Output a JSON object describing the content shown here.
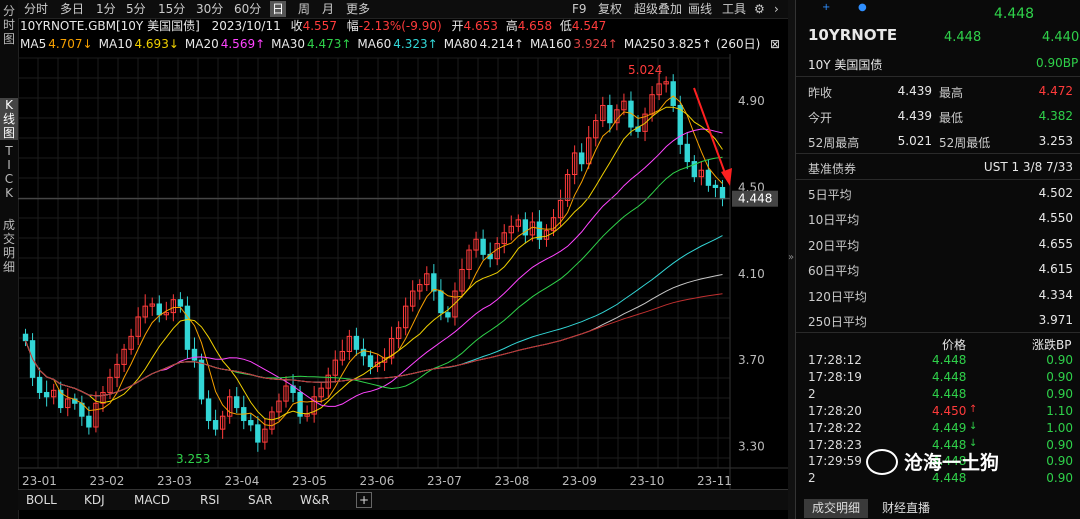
{
  "left_tabs": [
    "分\n时\n图",
    "K\n线\n图",
    "T\nI\nC\nK",
    "成\n交\n明\n细"
  ],
  "period_tabs": [
    "分时",
    "多日",
    "1分",
    "5分",
    "15分",
    "30分",
    "60分",
    "日",
    "周",
    "月",
    "更多"
  ],
  "toolbar_right": [
    "F9",
    "复权",
    "超级叠加",
    "画线",
    "工具"
  ],
  "quote": {
    "symbol": "10YRNOTE.GBM[10Y 美国国债]",
    "date": "2023/10/11",
    "close_label": "收",
    "close": "4.557",
    "change_label": "幅",
    "change": "-2.13%(-9.90)",
    "open_label": "开",
    "open": "4.653",
    "high_label": "高",
    "high": "4.658",
    "low_label": "低",
    "low": "4.547"
  },
  "ma": [
    {
      "label": "MA5",
      "value": "4.707↓",
      "color": "#f7a000"
    },
    {
      "label": "MA10",
      "value": "4.693↓",
      "color": "#f0d000"
    },
    {
      "label": "MA20",
      "value": "4.569↑",
      "color": "#ff44ff"
    },
    {
      "label": "MA30",
      "value": "4.473↑",
      "color": "#2fd14a"
    },
    {
      "label": "MA60",
      "value": "4.323↑",
      "color": "#33d6d6"
    },
    {
      "label": "MA80",
      "value": "4.214↑",
      "color": "#e8e8e8"
    },
    {
      "label": "MA160",
      "value": "3.924↑",
      "color": "#e04444"
    },
    {
      "label": "MA250",
      "value": "3.825↑",
      "color": "#e8e8e8"
    }
  ],
  "bars_count_label": "(260日)",
  "chart_data": {
    "type": "candlestick",
    "y_ticks": [
      "4.90",
      "4.50",
      "4.10",
      "3.70",
      "3.30"
    ],
    "x_ticks": [
      "23-01",
      "23-02",
      "23-03",
      "23-04",
      "23-05",
      "23-06",
      "23-07",
      "23-08",
      "23-09",
      "23-10",
      "23-11"
    ],
    "ylim": [
      3.2,
      5.1
    ],
    "last_price_tag": "4.448",
    "high_mark": "5.024",
    "low_mark": "3.253",
    "closes": [
      3.79,
      3.62,
      3.55,
      3.53,
      3.56,
      3.48,
      3.52,
      3.5,
      3.44,
      3.39,
      3.5,
      3.55,
      3.62,
      3.68,
      3.75,
      3.81,
      3.9,
      3.95,
      3.96,
      3.91,
      3.92,
      3.98,
      3.95,
      3.75,
      3.7,
      3.52,
      3.42,
      3.38,
      3.44,
      3.53,
      3.48,
      3.42,
      3.4,
      3.32,
      3.38,
      3.46,
      3.51,
      3.58,
      3.55,
      3.44,
      3.45,
      3.53,
      3.57,
      3.63,
      3.7,
      3.74,
      3.81,
      3.75,
      3.72,
      3.67,
      3.69,
      3.71,
      3.8,
      3.85,
      3.95,
      4.02,
      4.05,
      4.1,
      4.02,
      3.92,
      3.9,
      4.02,
      4.12,
      4.21,
      4.26,
      4.19,
      4.17,
      4.24,
      4.29,
      4.32,
      4.35,
      4.28,
      4.34,
      4.26,
      4.3,
      4.36,
      4.44,
      4.56,
      4.66,
      4.61,
      4.73,
      4.81,
      4.88,
      4.8,
      4.86,
      4.9,
      4.78,
      4.76,
      4.84,
      4.93,
      4.98,
      4.99,
      4.88,
      4.7,
      4.62,
      4.55,
      4.58,
      4.51,
      4.5,
      4.448
    ]
  },
  "indicator_tabs": [
    "BOLL",
    "KDJ",
    "MACD",
    "RSI",
    "SAR",
    "W&R"
  ],
  "rp": {
    "name": "10YRNOTE",
    "price_top": "4.448",
    "price_left": "4.448",
    "price_right": "4.440",
    "subtitle": "10Y 美国国债",
    "bp": "0.90BP",
    "stats": [
      {
        "k": "昨收",
        "v": "4.439",
        "k2": "最高",
        "v2": "4.472"
      },
      {
        "k": "今开",
        "v": "4.439",
        "k2": "最低",
        "v2": "4.382"
      },
      {
        "k": "52周最高",
        "v": "5.021",
        "k2": "52周最低",
        "v2": "3.253"
      }
    ],
    "bench_label": "基准债券",
    "bench_value": "UST 1 3/8 7/33",
    "averages": [
      {
        "k": "5日平均",
        "v": "4.502"
      },
      {
        "k": "10日平均",
        "v": "4.550"
      },
      {
        "k": "20日平均",
        "v": "4.655"
      },
      {
        "k": "60日平均",
        "v": "4.615"
      },
      {
        "k": "120日平均",
        "v": "4.334"
      },
      {
        "k": "250日平均",
        "v": "3.971"
      }
    ],
    "tick_headers": [
      "价格",
      "涨跌BP"
    ],
    "ticks": [
      {
        "t": "17:28:12",
        "p": "4.448",
        "a": "",
        "c": "0.90"
      },
      {
        "t": "17:28:19",
        "p": "4.448",
        "a": "",
        "c": "0.90"
      },
      {
        "t": "2",
        "p": "4.448",
        "a": "",
        "c": "0.90"
      },
      {
        "t": "17:28:20",
        "p": "4.450",
        "a": "↑",
        "c": "1.10"
      },
      {
        "t": "17:28:22",
        "p": "4.449",
        "a": "↓",
        "c": "1.00"
      },
      {
        "t": "17:28:23",
        "p": "4.448",
        "a": "↓",
        "c": "0.90"
      },
      {
        "t": "17:29:59",
        "p": "4.448",
        "a": "",
        "c": "0.90"
      },
      {
        "t": "2",
        "p": "4.448",
        "a": "",
        "c": "0.90"
      }
    ],
    "bottom_tabs": [
      "成交明细",
      "财经直播"
    ]
  },
  "watermark": "沧海一土狗"
}
